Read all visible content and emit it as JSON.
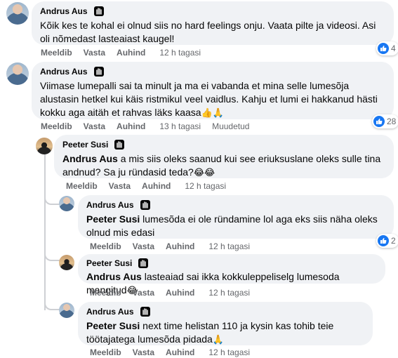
{
  "comments": [
    {
      "id": "c1",
      "author": "Andrus Aus",
      "avatar": "andrus-avatar",
      "text": "Kõik kes te kohal ei olnud siis no hard feelings onju. Vaata pilte ja videosi. Asi oli nõmedast lasteaiast kaugel!",
      "actions": {
        "like": "Meeldib",
        "reply": "Vasta",
        "share": "Auhind",
        "time": "12 h tagasi"
      },
      "reactions": "4"
    },
    {
      "id": "c2",
      "author": "Andrus Aus",
      "avatar": "andrus-avatar",
      "text": "Viimase lumepalli sai ta minult ja ma ei vabanda et mina selle lumesõja alustasin hetkel kui käis ristmikul veel vaidlus. Kahju et lumi ei hakkanud hästi kokku aga aitäh et rahvas läks kaasa",
      "text_emoji": "👍🙏",
      "actions": {
        "like": "Meeldib",
        "reply": "Vasta",
        "share": "Auhind",
        "time": "13 h tagasi",
        "edited": "Muudetud"
      },
      "reactions": "28"
    },
    {
      "id": "c3",
      "author": "Peeter Susi",
      "avatar": "peeter-avatar",
      "mention": "Andrus Aus",
      "text": "a mis siis oleks saanud kui see eriuksuslane oleks sulle tina andnud? Sa ju ründasid teda?",
      "text_emoji": "😂😂",
      "actions": {
        "like": "Meeldib",
        "reply": "Vasta",
        "share": "Auhind",
        "time": "12 h tagasi"
      }
    },
    {
      "id": "c4",
      "author": "Andrus Aus",
      "avatar": "andrus-avatar",
      "mention": "Peeter Susi",
      "text": "lumesõda ei ole ründamine lol aga eks siis näha oleks olnud mis edasi",
      "actions": {
        "like": "Meeldib",
        "reply": "Vasta",
        "share": "Auhind",
        "time": "12 h tagasi"
      },
      "reactions": "2"
    },
    {
      "id": "c5",
      "author": "Peeter Susi",
      "avatar": "peeter-avatar",
      "mention": "Andrus Aus",
      "text": "lasteaiad sai ikka kokkuleppeliselg lumesoda mangitud",
      "text_emoji": "😂",
      "actions": {
        "like": "Meeldib",
        "reply": "Vasta",
        "share": "Auhind",
        "time": "12 h tagasi"
      }
    },
    {
      "id": "c6",
      "author": "Andrus Aus",
      "avatar": "andrus-avatar",
      "mention": "Peeter Susi",
      "text": "next time helistan 110 ja kysin kas tohib teie töötajatega lumesõda pidada",
      "text_emoji": "🙏",
      "actions": {
        "like": "Meeldib",
        "reply": "Vasta",
        "share": "Auhind",
        "time": "12 h tagasi"
      }
    }
  ],
  "colors": {
    "bubble": "#f0f2f5",
    "meta": "#65676b",
    "like": "#1877f2"
  },
  "icons": {
    "badge": "waving-hand-icon",
    "reaction": "like-icon"
  }
}
